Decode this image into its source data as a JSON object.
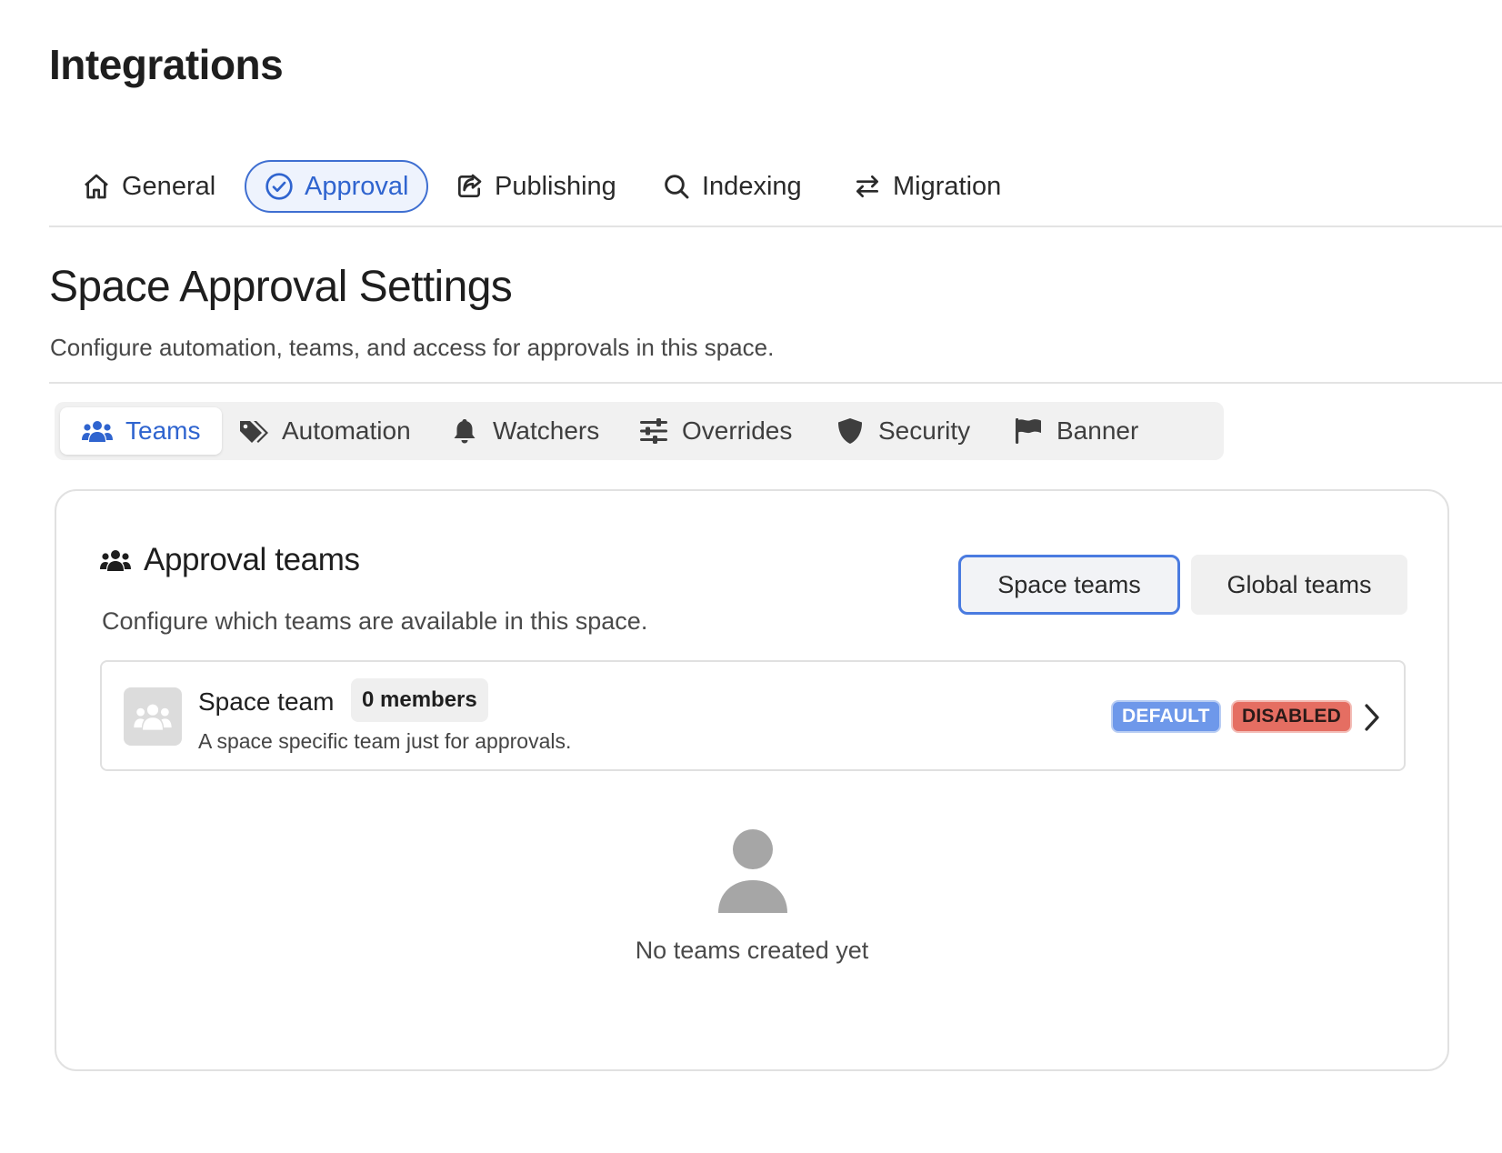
{
  "header": {
    "title": "Integrations"
  },
  "top_tabs": [
    {
      "label": "General",
      "icon": "home-icon",
      "active": false
    },
    {
      "label": "Approval",
      "icon": "check-circle-icon",
      "active": true
    },
    {
      "label": "Publishing",
      "icon": "share-icon",
      "active": false
    },
    {
      "label": "Indexing",
      "icon": "search-icon",
      "active": false
    },
    {
      "label": "Migration",
      "icon": "swap-icon",
      "active": false
    }
  ],
  "section": {
    "title": "Space Approval Settings",
    "description": "Configure automation, teams, and access for approvals in this space."
  },
  "sub_tabs": [
    {
      "label": "Teams",
      "icon": "users-icon",
      "active": true
    },
    {
      "label": "Automation",
      "icon": "tags-icon",
      "active": false
    },
    {
      "label": "Watchers",
      "icon": "bell-icon",
      "active": false
    },
    {
      "label": "Overrides",
      "icon": "sliders-icon",
      "active": false
    },
    {
      "label": "Security",
      "icon": "shield-icon",
      "active": false
    },
    {
      "label": "Banner",
      "icon": "flag-icon",
      "active": false
    }
  ],
  "card": {
    "title": "Approval teams",
    "description": "Configure which teams are available in this space.",
    "toggle": {
      "space_label": "Space teams",
      "global_label": "Global teams",
      "selected": "Space teams"
    },
    "team": {
      "name": "Space team",
      "members": "0 members",
      "description": "A space specific team just for approvals.",
      "badges": [
        "DEFAULT",
        "DISABLED"
      ]
    },
    "empty_state": "No teams created yet"
  },
  "colors": {
    "accent": "#2f64cf",
    "accent_border": "#3f6fd1",
    "badge_default": "#6e98ea",
    "badge_disabled": "#e56e62"
  }
}
